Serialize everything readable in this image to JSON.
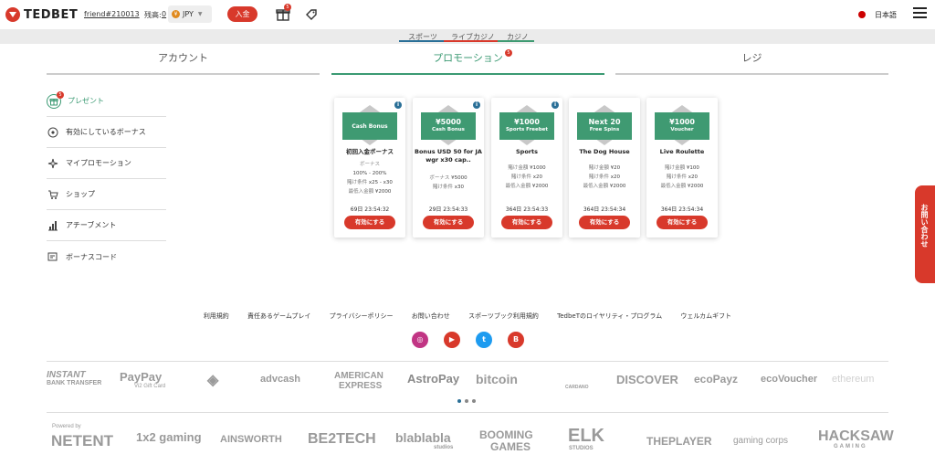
{
  "header": {
    "brand": "TEDBET",
    "username": "friend#210013",
    "balance_label": "残高:",
    "balance_value": "0",
    "currency": "JPY",
    "deposit_label": "入金",
    "gift_count": "5",
    "language": "日本語"
  },
  "subnav": {
    "items": [
      "スポーツ",
      "ライブカジノ",
      "カジノ"
    ],
    "colors": [
      "#2a6f97",
      "#d8392b",
      "#3f9a72"
    ]
  },
  "tabs": [
    {
      "label": "アカウント"
    },
    {
      "label": "プロモーション",
      "badge": "5"
    },
    {
      "label": "レジ"
    }
  ],
  "sidebar": {
    "items": [
      {
        "label": "プレゼント",
        "badge": "5",
        "icon": "gift-icon"
      },
      {
        "label": "有効にしているボーナス",
        "icon": "badge-icon"
      },
      {
        "label": "マイプロモーション",
        "icon": "sparkle-icon"
      },
      {
        "label": "ショップ",
        "icon": "cart-icon"
      },
      {
        "label": "アチーブメント",
        "icon": "chart-icon"
      },
      {
        "label": "ボーナスコード",
        "icon": "code-icon"
      }
    ]
  },
  "cards": [
    {
      "amount": "",
      "kind": "Cash Bonus",
      "title": "初回入金ボーナス",
      "lines": [
        [
          "",
          "ボーナス"
        ],
        [
          "",
          "100% - 200%"
        ],
        [
          "賭け条件",
          "x25 - x30"
        ],
        [
          "最低入金額",
          "¥2000"
        ]
      ],
      "timer": "69日 23:54:32",
      "button": "有効にする"
    },
    {
      "amount": "¥5000",
      "kind": "Cash Bonus",
      "title": "Bonus USD 50 for JA wgr x30 cap..",
      "lines": [
        [
          "ボーナス",
          "¥5000"
        ],
        [
          "賭け条件",
          "x30"
        ]
      ],
      "timer": "29日 23:54:33",
      "button": "有効にする"
    },
    {
      "amount": "¥1000",
      "kind": "Sports Freebet",
      "title": "Sports",
      "lines": [
        [
          "賭け金額",
          "¥1000"
        ],
        [
          "賭け条件",
          "x20"
        ],
        [
          "最低入金額",
          "¥2000"
        ]
      ],
      "timer": "364日 23:54:33",
      "button": "有効にする"
    },
    {
      "amount": "Next 20",
      "kind": "Free Spins",
      "title": "The Dog House",
      "lines": [
        [
          "賭け金額",
          "¥20"
        ],
        [
          "賭け条件",
          "x20"
        ],
        [
          "最低入金額",
          "¥2000"
        ]
      ],
      "timer": "364日 23:54:34",
      "button": "有効にする"
    },
    {
      "amount": "¥1000",
      "kind": "Voucher",
      "title": "Live Roulette",
      "lines": [
        [
          "賭け金額",
          "¥100"
        ],
        [
          "賭け条件",
          "x20"
        ],
        [
          "最低入金額",
          "¥2000"
        ]
      ],
      "timer": "364日 23:54:34",
      "button": "有効にする"
    }
  ],
  "contact_tab": "お問い合わせ",
  "footer": {
    "links": [
      "利用規約",
      "責任あるゲームプレイ",
      "プライバシーポリシー",
      "お問い合わせ",
      "スポーツブック利用規約",
      "TedbeTのロイヤリティ・プログラム",
      "ウェルカムギフト"
    ],
    "socials": [
      {
        "name": "instagram-icon",
        "glyph": "◎",
        "color": "#c13584"
      },
      {
        "name": "youtube-icon",
        "glyph": "▶",
        "color": "#d8392b"
      },
      {
        "name": "twitter-icon",
        "glyph": "t",
        "color": "#1d9bf0"
      },
      {
        "name": "blog-icon",
        "glyph": "B",
        "color": "#d8392b"
      }
    ],
    "payments": [
      "INSTANT",
      "BANK TRANSFER",
      "PayPay",
      "Vi2 Gift Card",
      "◈",
      "advcash",
      "AMERICAN",
      "EXPRESS",
      "AstroPay",
      "bitcoin",
      "CARDANO",
      "DISCOVER",
      "ecoPayz",
      "ecoVoucher",
      "ethereum"
    ],
    "providers": [
      "Powered by",
      "NETENT",
      "1x2 gaming",
      "AINSWORTH",
      "BE2TECH",
      "blablabla",
      "studios",
      "BOOMING",
      "GAMES",
      "ELK",
      "STUDIOS",
      "THEPLAYER",
      "gaming corps",
      "HACKSAW",
      "GAMING"
    ]
  }
}
